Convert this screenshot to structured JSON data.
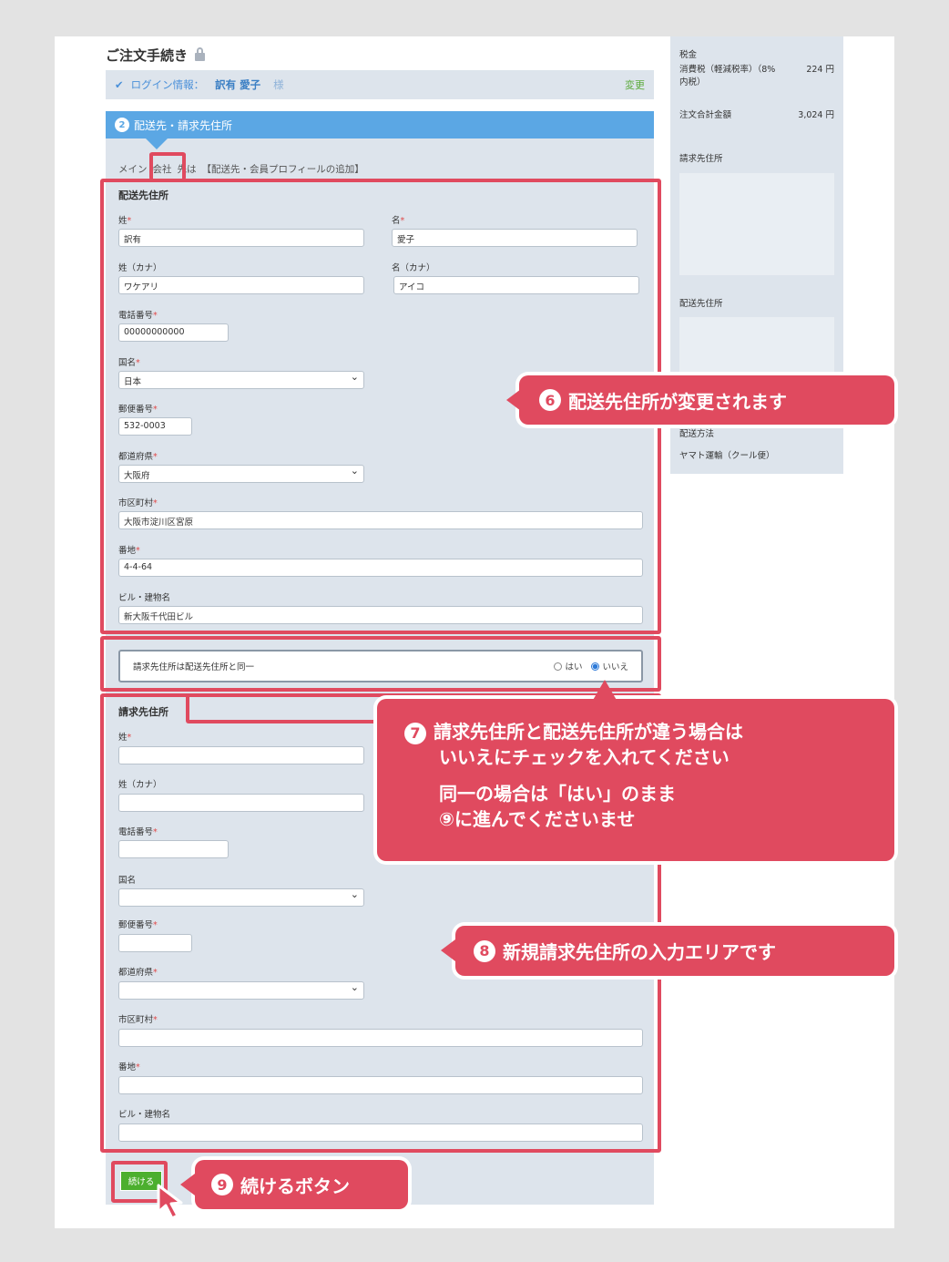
{
  "header": {
    "title": "ご注文手続き",
    "lock_icon": "lock-icon"
  },
  "login": {
    "label": "ログイン情報：",
    "name": "訳有 愛子",
    "honorific": "様",
    "change": "変更"
  },
  "step": {
    "number": "2",
    "label": "配送先・請求先住所"
  },
  "tabs": [
    "メイン",
    "会社",
    "先は",
    "【配送先・会員プロフィールの追加】"
  ],
  "shipping": {
    "section": "配送先住所",
    "last_name_label": "姓",
    "last_name": "訳有",
    "first_name_label": "名",
    "first_name": "愛子",
    "last_kana_label": "姓（カナ）",
    "last_kana": "ワケアリ",
    "first_kana_label": "名（カナ）",
    "first_kana": "アイコ",
    "phone_label": "電話番号",
    "phone": "00000000000",
    "country_label": "国名",
    "country": "日本",
    "zip_label": "郵便番号",
    "zip": "532-0003",
    "pref_label": "都道府県",
    "pref": "大阪府",
    "city_label": "市区町村",
    "city": "大阪市淀川区宮原",
    "street_label": "番地",
    "street": "4-4-64",
    "building_label": "ビル・建物名",
    "building": "新大阪千代田ビル",
    "required_mark": "*"
  },
  "same_address": {
    "label": "請求先住所は配送先住所と同一",
    "yes": "はい",
    "no": "いいえ"
  },
  "billing": {
    "section": "請求先住所",
    "last_name_label": "姓",
    "last_kana_label": "姓（カナ）",
    "phone_label": "電話番号",
    "country_label": "国名",
    "zip_label": "郵便番号",
    "pref_label": "都道府県",
    "city_label": "市区町村",
    "street_label": "番地",
    "building_label": "ビル・建物名"
  },
  "continue_button": "続ける",
  "sidebar": {
    "fee": "税金",
    "tax_label": "消費税（軽減税率）（8% 内税）",
    "tax_value": "224 円",
    "total_label": "注文合計金額",
    "total_value": "3,024 円",
    "billing_label": "請求先住所",
    "shipping_label": "配送先住所",
    "method_label": "配送方法",
    "method_value": "ヤマト運輸（クール便）"
  },
  "callouts": {
    "c6_num": "6",
    "c6": "配送先住所が変更されます",
    "c7_num": "7",
    "c7_l1": "請求先住所と配送先住所が違う場合は",
    "c7_l2": "いいえにチェックを入れてください",
    "c7_l3": "同一の場合は「はい」のまま",
    "c7_l4": "⑨に進んでくださいませ",
    "c8_num": "8",
    "c8": "新規請求先住所の入力エリアです",
    "c9_num": "9",
    "c9": "続けるボタン"
  },
  "colors": {
    "accent_red": "#e04a5f",
    "step_blue": "#5ba7e4",
    "button_green": "#4caf2e"
  }
}
